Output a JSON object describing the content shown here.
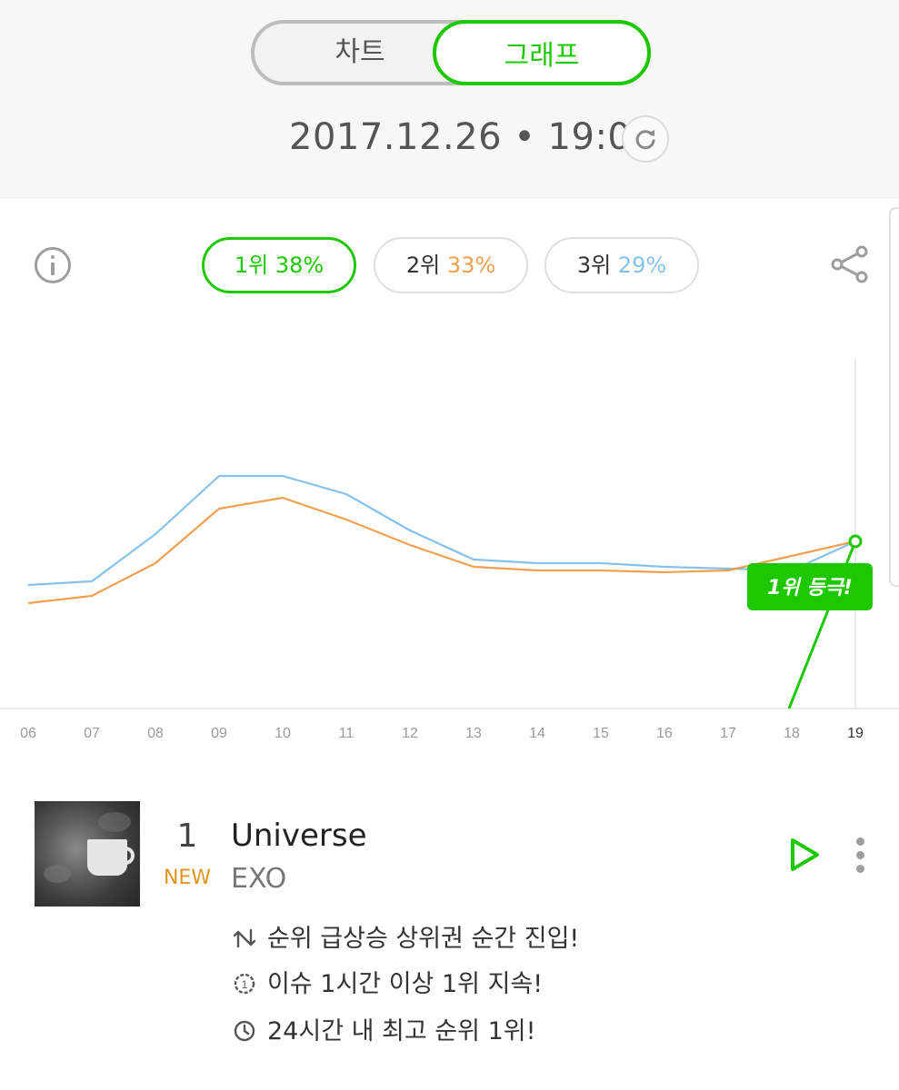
{
  "toggle": {
    "chart_label": "차트",
    "graph_label": "그래프",
    "selected": "그래프"
  },
  "header": {
    "datetime": "2017.12.26 • 19:00"
  },
  "icons": {
    "refresh": "refresh-icon",
    "info": "info-icon",
    "share": "share-icon",
    "play": "play-icon",
    "more": "more-vertical-icon",
    "rank_up": "rank-up-icon",
    "sustain": "sustain-icon",
    "clock": "clock-icon"
  },
  "legend": {
    "items": [
      {
        "rank": "1위",
        "percent": "38%"
      },
      {
        "rank": "2위",
        "percent": "33%"
      },
      {
        "rank": "3위",
        "percent": "29%"
      }
    ]
  },
  "colors": {
    "accent": "#1ec800",
    "second": "#f0a050",
    "third": "#85c1ea"
  },
  "chart_data": {
    "type": "line",
    "x": [
      "06",
      "07",
      "08",
      "09",
      "10",
      "11",
      "12",
      "13",
      "14",
      "15",
      "16",
      "17",
      "18",
      "19"
    ],
    "ylim": [
      0,
      100
    ],
    "grid": false,
    "series": [
      {
        "values": [
          null,
          null,
          null,
          null,
          null,
          null,
          null,
          null,
          null,
          null,
          null,
          null,
          null,
          46
        ]
      },
      {
        "values": [
          29,
          31,
          40,
          55,
          58,
          52,
          45,
          39,
          38,
          38,
          37.5,
          38,
          42,
          46
        ]
      },
      {
        "values": [
          34,
          35,
          48,
          64,
          64,
          59,
          49,
          41,
          40,
          40,
          39,
          38.5,
          38,
          46
        ]
      }
    ],
    "annotation": {
      "x": "19",
      "text": "1위 등극!"
    }
  },
  "song": {
    "rank": "1",
    "badge": "NEW",
    "title": "Universe",
    "artist": "EXO"
  },
  "features": [
    "순위 급상승 상위권 순간 진입!",
    "이슈 1시간 이상 1위 지속!",
    "24시간 내 최고 순위 1위!"
  ]
}
